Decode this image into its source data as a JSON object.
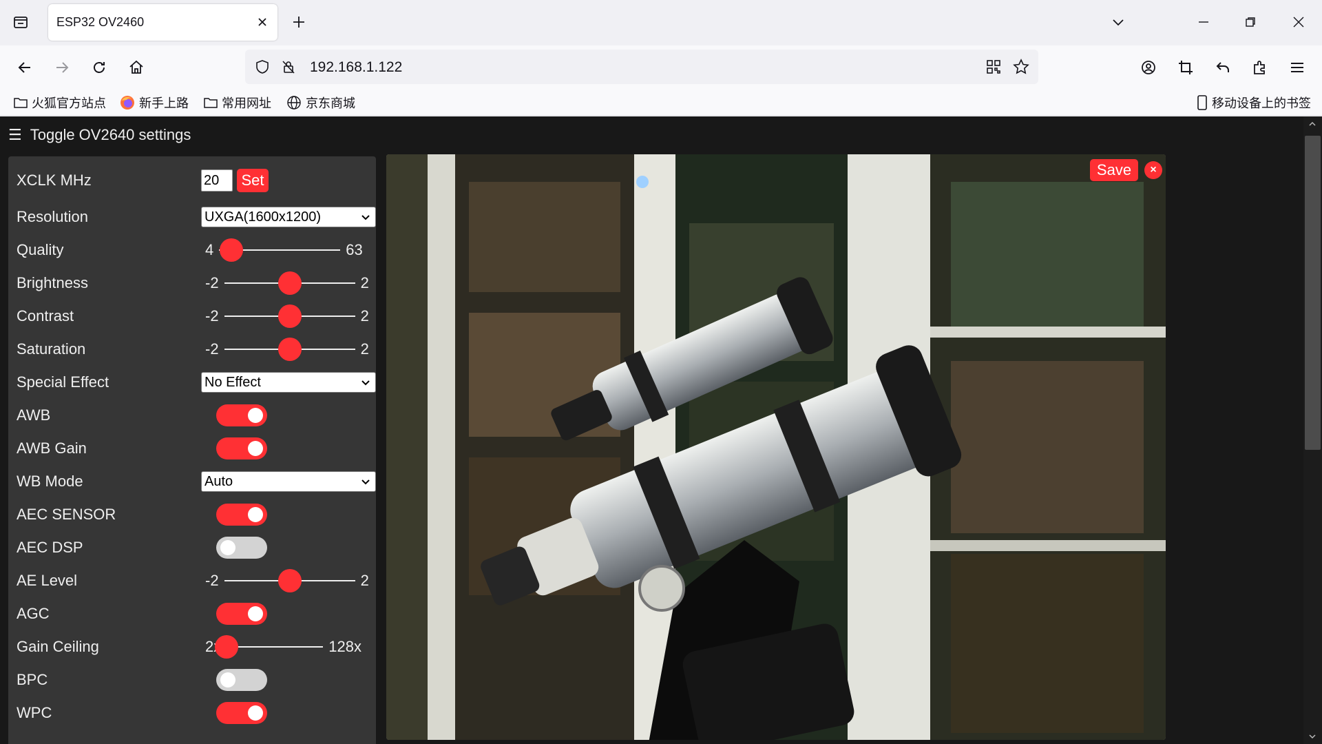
{
  "browser": {
    "tab_title": "ESP32 OV2460",
    "url": "192.168.1.122",
    "bookmarks": [
      {
        "label": "火狐官方站点",
        "icon": "folder-icon"
      },
      {
        "label": "新手上路",
        "icon": "firefox-icon"
      },
      {
        "label": "常用网址",
        "icon": "folder-icon"
      },
      {
        "label": "京东商城",
        "icon": "globe-icon"
      }
    ],
    "mobile_bookmarks": "移动设备上的书签"
  },
  "page": {
    "toggle_label": "Toggle OV2640 settings",
    "save_label": "Save",
    "close_label": "×"
  },
  "settings": {
    "xclk": {
      "label": "XCLK MHz",
      "value": "20",
      "button": "Set"
    },
    "resolution": {
      "label": "Resolution",
      "value": "UXGA(1600x1200)"
    },
    "quality": {
      "label": "Quality",
      "min": "4",
      "max": "63",
      "value": 10
    },
    "brightness": {
      "label": "Brightness",
      "min": "-2",
      "max": "2",
      "value": 0
    },
    "contrast": {
      "label": "Contrast",
      "min": "-2",
      "max": "2",
      "value": 0
    },
    "saturation": {
      "label": "Saturation",
      "min": "-2",
      "max": "2",
      "value": 0
    },
    "special_effect": {
      "label": "Special Effect",
      "value": "No Effect"
    },
    "awb": {
      "label": "AWB",
      "on": true
    },
    "awb_gain": {
      "label": "AWB Gain",
      "on": true
    },
    "wb_mode": {
      "label": "WB Mode",
      "value": "Auto"
    },
    "aec_sensor": {
      "label": "AEC SENSOR",
      "on": true
    },
    "aec_dsp": {
      "label": "AEC DSP",
      "on": false
    },
    "ae_level": {
      "label": "AE Level",
      "min": "-2",
      "max": "2",
      "value": 0
    },
    "agc": {
      "label": "AGC",
      "on": true
    },
    "gain_ceiling": {
      "label": "Gain Ceiling",
      "min": "2x",
      "max": "128x",
      "value": 0
    },
    "bpc": {
      "label": "BPC",
      "on": false
    },
    "wpc": {
      "label": "WPC",
      "on": true
    }
  },
  "colors": {
    "accent": "#ff3034",
    "panel": "#363636",
    "page_bg": "#181818"
  }
}
